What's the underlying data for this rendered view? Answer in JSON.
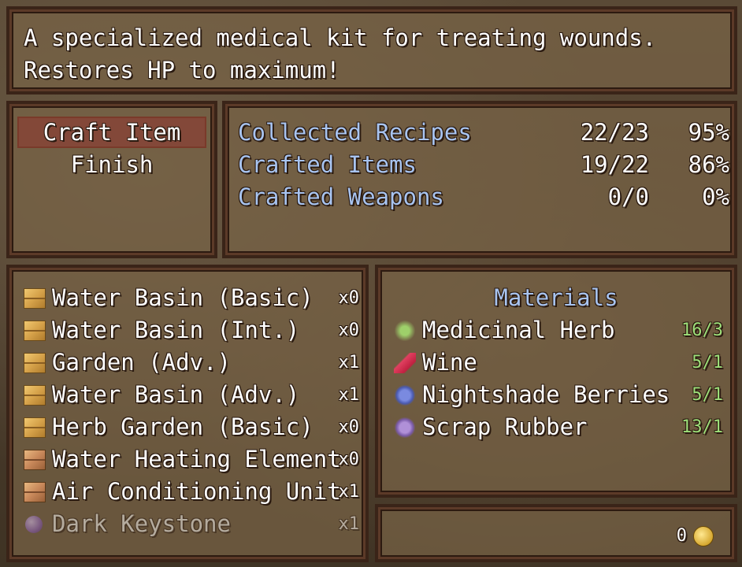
{
  "help": {
    "line1": "A specialized medical kit for treating wounds.",
    "line2": "Restores HP to maximum!"
  },
  "commands": [
    {
      "label": "Craft Item"
    },
    {
      "label": "Finish"
    }
  ],
  "stats": [
    {
      "label": "Collected Recipes",
      "count": "22/23",
      "percent": "95%"
    },
    {
      "label": "Crafted Items",
      "count": "19/22",
      "percent": "86%"
    },
    {
      "label": "Crafted Weapons",
      "count": "0/0",
      "percent": "0%"
    }
  ],
  "items": [
    {
      "name": "Water Basin (Basic)",
      "qty": "x0",
      "icon": "crate-icon"
    },
    {
      "name": "Water Basin (Int.)",
      "qty": "x0",
      "icon": "crate-icon"
    },
    {
      "name": "Garden (Adv.)",
      "qty": "x1",
      "icon": "crate-icon"
    },
    {
      "name": "Water Basin (Adv.)",
      "qty": "x1",
      "icon": "crate-icon"
    },
    {
      "name": "Herb Garden (Basic)",
      "qty": "x0",
      "icon": "crate-icon"
    },
    {
      "name": "Water Heating Element",
      "qty": "x0",
      "icon": "crate-icon"
    },
    {
      "name": "Air Conditioning Unit",
      "qty": "x1",
      "icon": "crate-icon"
    },
    {
      "name": "Dark Keystone",
      "qty": "x1",
      "icon": "orb-icon"
    }
  ],
  "materials": {
    "title": "Materials",
    "entries": [
      {
        "name": "Medicinal Herb",
        "qty": "16/3",
        "icon": "herb-icon"
      },
      {
        "name": "Wine",
        "qty": "5/1",
        "icon": "wine-bottle-icon"
      },
      {
        "name": "Nightshade Berries",
        "qty": "5/1",
        "icon": "berries-icon"
      },
      {
        "name": "Scrap Rubber",
        "qty": "13/1",
        "icon": "rubber-icon"
      }
    ]
  },
  "gold": {
    "value": "0",
    "icon": "gold-coin-icon"
  }
}
